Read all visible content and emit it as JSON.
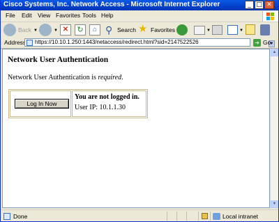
{
  "window": {
    "title": "Cisco Systems, Inc. Network Access - Microsoft Internet Explorer",
    "min_glyph": "_",
    "max_glyph": "□",
    "close_glyph": "✕"
  },
  "menu": {
    "file": "File",
    "edit": "Edit",
    "view": "View",
    "favorites": "Favorites",
    "tools": "Tools",
    "help": "Help"
  },
  "toolbar": {
    "back": "Back",
    "search": "Search",
    "favorites": "Favorites"
  },
  "address": {
    "label": "Address",
    "url": "https://10.10.1.250:1443/netaccess/redirect.html?sid=2147522526",
    "go": "Go"
  },
  "page": {
    "heading": "Network User Authentication",
    "line_prefix": "Network User Authentication is ",
    "line_em": "required",
    "line_suffix": ".",
    "login_button": "Log In Now",
    "status_title": "You are not logged in.",
    "user_ip": "User IP: 10.1.1.30"
  },
  "statusbar": {
    "text": "Done",
    "zone": "Local intranet"
  },
  "colors": {
    "titlebar": "#0a5ae8",
    "chrome": "#ece9d8",
    "table_border": "#c8b88a"
  }
}
